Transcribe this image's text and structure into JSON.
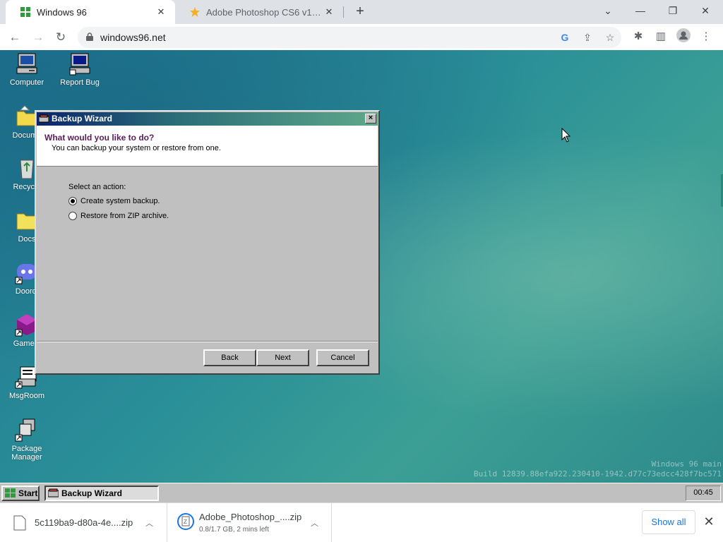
{
  "browser": {
    "tabs": [
      {
        "title": "Windows 96",
        "active": true
      },
      {
        "title": "Adobe Photoshop CS6 v13.0 Dow",
        "active": false
      }
    ],
    "url": "windows96.net"
  },
  "desktop": {
    "icons": [
      {
        "label": "Computer"
      },
      {
        "label": "Report Bug"
      },
      {
        "label": "Docume"
      },
      {
        "label": "Recycle"
      },
      {
        "label": "Docs"
      },
      {
        "label": "Doordi"
      },
      {
        "label": "Gamein"
      },
      {
        "label": "MsgRoom"
      },
      {
        "label": "Package Manager"
      }
    ],
    "build_line1": "Windows 96 main",
    "build_line2": "Build 12839.88efa922.230410-1942.d77c73edcc428f7bc571"
  },
  "wizard": {
    "title": "Backup Wizard",
    "close_label": "×",
    "question": "What would you like to do?",
    "subtitle": "You can backup your system or restore from one.",
    "select_label": "Select an action:",
    "options": [
      {
        "label": "Create system backup.",
        "checked": true
      },
      {
        "label": "Restore from ZIP archive.",
        "checked": false
      }
    ],
    "buttons": {
      "back": "Back",
      "next": "Next",
      "cancel": "Cancel"
    }
  },
  "taskbar": {
    "start_label": "Start",
    "task_label": "Backup Wizard",
    "clock": "00:45"
  },
  "downloads": {
    "items": [
      {
        "name": "5c119ba9-d80a-4e....zip",
        "status": ""
      },
      {
        "name": "Adobe_Photoshop_....zip",
        "status": "0.8/1.7 GB, 2 mins left"
      }
    ],
    "show_all": "Show all"
  }
}
